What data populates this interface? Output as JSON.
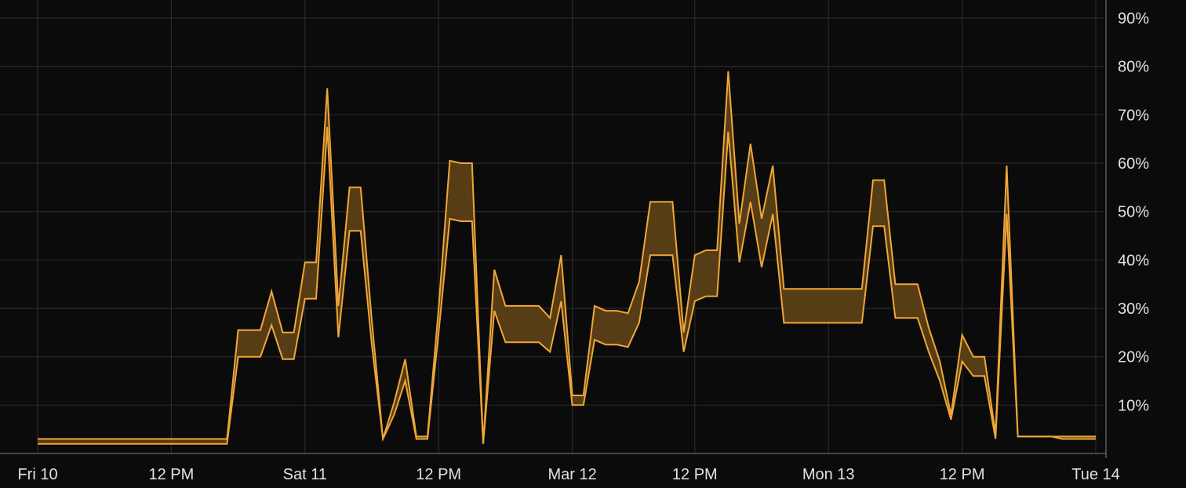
{
  "chart_data": {
    "type": "area",
    "title": "",
    "xlabel": "",
    "ylabel": "",
    "grid": true,
    "colors": {
      "background": "#0b0b0b",
      "series": "#f0a637",
      "band": "#5b4016",
      "grid": "#2a2a2a",
      "text": "#e2e2e2"
    },
    "x_axis": {
      "range_hours": [
        0,
        96
      ],
      "ticks": [
        {
          "t": 0,
          "label": "Fri 10"
        },
        {
          "t": 12,
          "label": "12 PM"
        },
        {
          "t": 24,
          "label": "Sat 11"
        },
        {
          "t": 36,
          "label": "12 PM"
        },
        {
          "t": 48,
          "label": "Mar 12"
        },
        {
          "t": 59,
          "label": "12 PM"
        },
        {
          "t": 71,
          "label": "Mon 13"
        },
        {
          "t": 83,
          "label": "12 PM"
        },
        {
          "t": 95,
          "label": "Tue 14"
        }
      ]
    },
    "y_axis": {
      "range": [
        0,
        90
      ],
      "unit": "%",
      "ticks": [
        {
          "v": 10,
          "label": "10%"
        },
        {
          "v": 20,
          "label": "20%"
        },
        {
          "v": 30,
          "label": "30%"
        },
        {
          "v": 40,
          "label": "40%"
        },
        {
          "v": 50,
          "label": "50%"
        },
        {
          "v": 60,
          "label": "60%"
        },
        {
          "v": 70,
          "label": "70%"
        },
        {
          "v": 80,
          "label": "80%"
        },
        {
          "v": 90,
          "label": "90%"
        }
      ]
    },
    "x": [
      0,
      17,
      18,
      20,
      21,
      22,
      23,
      24,
      25,
      26,
      27,
      28,
      29,
      30,
      31,
      32,
      33,
      34,
      35,
      36,
      37,
      38,
      39,
      40,
      41,
      42,
      43,
      44,
      45,
      46,
      47,
      48,
      49,
      50,
      51,
      52,
      53,
      54,
      55,
      56,
      57,
      58,
      59,
      60,
      61,
      62,
      63,
      64,
      65,
      66,
      67,
      68,
      69,
      70,
      71,
      72,
      73,
      74,
      75,
      76,
      77,
      78,
      79,
      80,
      81,
      82,
      83,
      84,
      85,
      86,
      87,
      88,
      89,
      90,
      91,
      92,
      93,
      94,
      95
    ],
    "series": [
      {
        "role": "upper",
        "values": [
          3,
          3,
          25.5,
          25.5,
          33.5,
          25,
          25,
          39.5,
          39.5,
          75.5,
          30.5,
          55,
          55,
          27.5,
          3,
          10.5,
          19.5,
          3.5,
          3.5,
          30,
          60.5,
          60,
          60,
          2,
          38,
          30.5,
          30.5,
          30.5,
          30.5,
          28,
          41,
          12,
          12,
          30.5,
          29.5,
          29.5,
          29,
          35.5,
          52,
          52,
          52,
          25,
          41,
          42,
          42,
          79,
          47.5,
          64,
          48.5,
          59.5,
          34,
          34,
          34,
          34,
          34,
          34,
          34,
          34,
          56.5,
          56.5,
          35,
          35,
          35,
          26,
          19,
          8,
          24.5,
          20,
          20,
          4,
          59.5,
          3.5,
          3.5,
          3.5,
          3.5,
          3.5,
          3.5,
          3.5,
          3.5
        ]
      },
      {
        "role": "lower",
        "values": [
          2,
          2,
          20,
          20,
          26.5,
          19.5,
          19.5,
          32,
          32,
          67.5,
          24,
          46,
          46,
          22.5,
          3,
          8,
          15,
          3,
          3,
          25,
          48.5,
          48,
          48,
          2,
          29.5,
          23,
          23,
          23,
          23,
          21,
          31.5,
          10,
          10,
          23.5,
          22.5,
          22.5,
          22,
          27,
          41,
          41,
          41,
          21,
          31.5,
          32.5,
          32.5,
          66.5,
          39.5,
          52,
          38.5,
          49.5,
          27,
          27,
          27,
          27,
          27,
          27,
          27,
          27,
          47,
          47,
          28,
          28,
          28,
          21,
          15,
          7,
          19,
          16,
          16,
          3,
          49.5,
          3.5,
          3.5,
          3.5,
          3.5,
          3,
          3,
          3,
          3
        ]
      }
    ]
  }
}
